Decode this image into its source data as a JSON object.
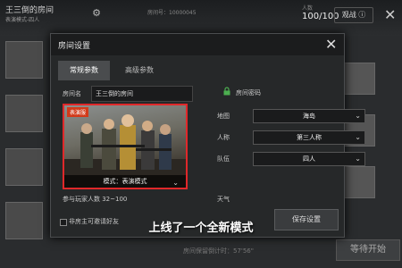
{
  "background": {
    "room_title": "王三倒的房间",
    "room_subtitle": "表演模式-四人",
    "room_id": "房间号：10000045",
    "player_count_label": "人数",
    "player_count": "100/100",
    "mode_button": "观战",
    "countdown": "房间保留倒计时：57'56\"",
    "start_button": "等待开始"
  },
  "dialog": {
    "title": "房间设置",
    "tabs": [
      "常规参数",
      "高级参数"
    ],
    "room_name_label": "房间名",
    "room_name_value": "王三倒的房间",
    "password_label": "房间密码",
    "map_badge": "表演服",
    "map_caption": "模式：表演模式",
    "players_label": "参与玩家人数 32~100",
    "weather_label": "天气",
    "fields": {
      "map_label": "地图",
      "map_value": "海岛",
      "view_label": "人称",
      "view_value": "第三人称",
      "team_label": "队伍",
      "team_value": "四人"
    },
    "invite_label": "非房主可邀请好友",
    "save_button": "保存设置"
  },
  "subtitle_text": "上线了一个全新模式",
  "colors": {
    "accent_red": "#e0282a",
    "panel": "#262829"
  }
}
